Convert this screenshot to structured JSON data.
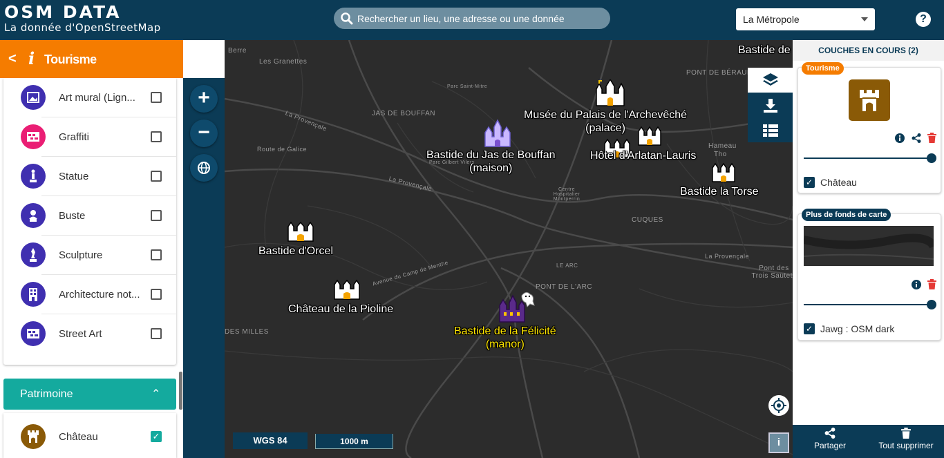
{
  "header": {
    "logo_title": "OSM DATA",
    "logo_subtitle": "La donnée d'OpenStreetMap",
    "search_placeholder": "Rechercher un lieu, une adresse ou une donnée",
    "territory_select": "La Métropole",
    "help_label": "?"
  },
  "left_panel": {
    "title": "Tourisme",
    "items": [
      {
        "label": "Art mural (Lign...",
        "color": "#3f2fb0",
        "checked": false
      },
      {
        "label": "Graffiti",
        "color": "#ea1e74",
        "checked": false
      },
      {
        "label": "Statue",
        "color": "#3f2fb0",
        "checked": false
      },
      {
        "label": "Buste",
        "color": "#3f2fb0",
        "checked": false
      },
      {
        "label": "Sculpture",
        "color": "#3f2fb0",
        "checked": false
      },
      {
        "label": "Architecture not...",
        "color": "#3f2fb0",
        "checked": false
      },
      {
        "label": "Street Art",
        "color": "#3f2fb0",
        "checked": false
      }
    ],
    "section": "Patrimoine",
    "section_item": {
      "label": "Château",
      "color": "#8a5a07",
      "checked": true
    }
  },
  "map": {
    "place_labels": [
      "Les Granettes",
      "Berre",
      "Parc Saint-Mitre",
      "JAS DE BOUFFAN",
      "La Provençale",
      "Route de Galice",
      "Parc Gilbert Vilers",
      "La Provençale",
      "Centre Hospitalier Montperrin",
      "CUQUES",
      "PONT DE BÉRAUD",
      "Hameau",
      "Tho",
      "Avenue du Camp de Menthe",
      "PONT DE L'ARC",
      "LE ARC",
      "La Provençale",
      "Pont des Trois Sautets",
      "DES MILLES"
    ],
    "pois": [
      {
        "name": "Musée du Palais de l'Archevêché",
        "kind": "(palace)"
      },
      {
        "name": "Bastide du Jas de Bouffan",
        "kind": "(maison)"
      },
      {
        "name": "Hôtel d'Arlatan-Lauris",
        "kind": ""
      },
      {
        "name": "Bastide la Torse",
        "kind": ""
      },
      {
        "name": "Bastide d'Orcel",
        "kind": ""
      },
      {
        "name": "Château de la Pioline",
        "kind": ""
      },
      {
        "name": "Bastide de la Félicité",
        "kind": "(manor)"
      },
      {
        "name": "Bastide de",
        "kind": ""
      }
    ],
    "projection": "WGS 84",
    "scale": "1000 m",
    "info_button": "i"
  },
  "right_panel": {
    "title": "COUCHES EN COURS (2)",
    "layers": [
      {
        "badge": "Tourisme",
        "badge_color": "#f57c00",
        "name": "Château",
        "icon_color": "#8a5a07",
        "opacity": 1.0
      },
      {
        "badge": "Plus de fonds de carte",
        "badge_color": "#0b3b56",
        "name": "Jawg : OSM dark",
        "opacity": 1.0
      }
    ],
    "footer": {
      "share": "Partager",
      "delete_all": "Tout supprimer"
    }
  }
}
